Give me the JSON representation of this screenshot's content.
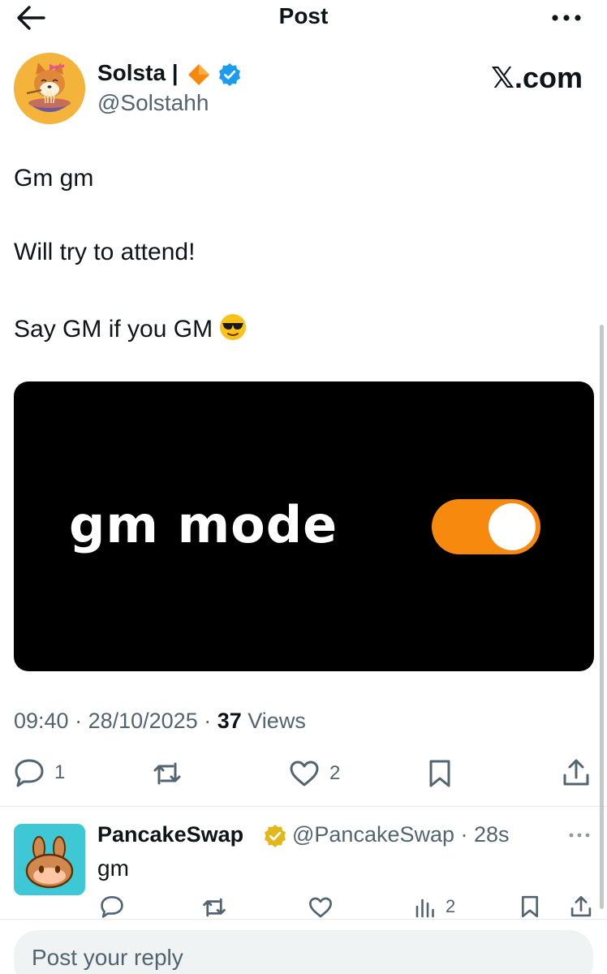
{
  "header": {
    "title": "Post"
  },
  "post": {
    "author": {
      "name": "Solsta |",
      "handle": "@Solstahh"
    },
    "watermark": "𝕏.com",
    "lines": [
      "Gm gm",
      "Will try to attend!",
      "Say GM if you GM"
    ],
    "emoji": "😎",
    "media": {
      "text": "gm mode",
      "toggle_on": true,
      "toggle_color": "#f7890f"
    },
    "time": "09:40",
    "date": "28/10/2025",
    "views_count": "37",
    "views_label": "Views",
    "replies": "1",
    "likes": "2"
  },
  "reply": {
    "name": "PancakeSwap",
    "handle": "@PancakeSwap · 28s",
    "text": "gm",
    "views": "2"
  },
  "reply_box": {
    "placeholder": "Post your reply"
  },
  "colors": {
    "accent_blue": "#1d9bf0",
    "gold_badge": "#e2b719",
    "muted_text": "#536471",
    "media_toggle": "#f7890f"
  },
  "icons": {
    "back": "arrow-left-icon",
    "more": "more-horizontal-icon",
    "reply": "comment-icon",
    "repost": "repost-icon",
    "like": "heart-icon",
    "bookmark": "bookmark-icon",
    "share": "share-icon",
    "views": "bar-chart-icon"
  }
}
